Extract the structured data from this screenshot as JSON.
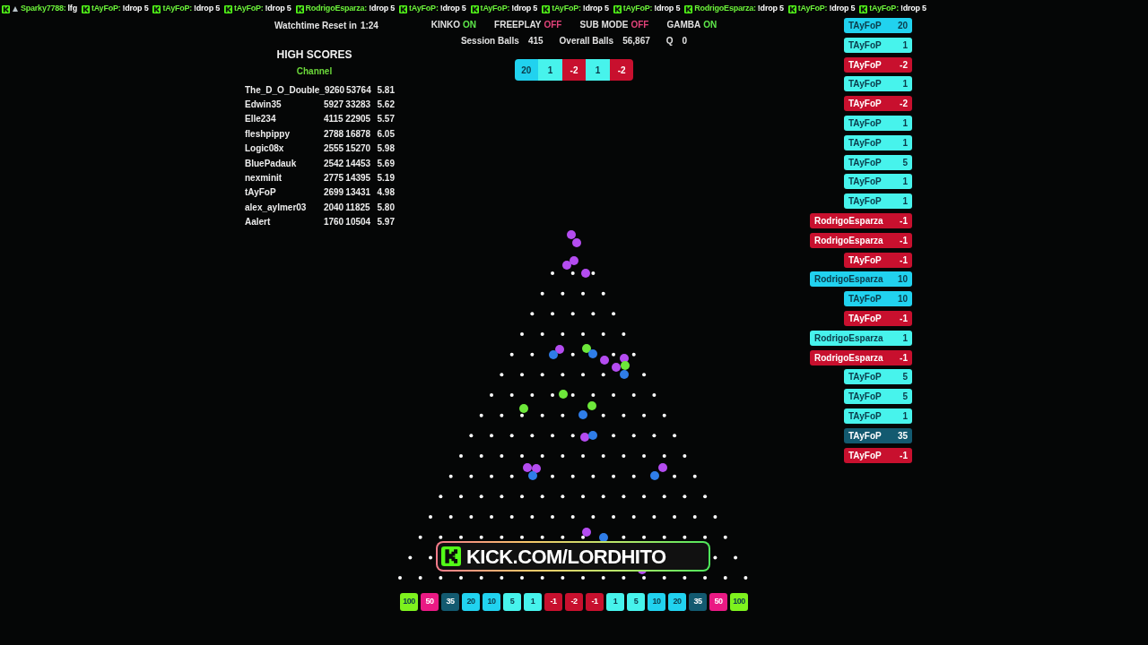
{
  "ticker": [
    {
      "user": "Sparky7788:",
      "text": "lfg",
      "badge": true
    },
    {
      "user": "tAyFoP:",
      "text": "!drop 5",
      "badge": false
    },
    {
      "user": "tAyFoP:",
      "text": "!drop 5",
      "badge": false
    },
    {
      "user": "tAyFoP:",
      "text": "!drop 5",
      "badge": false
    },
    {
      "user": "RodrigoEsparza:",
      "text": "!drop 5",
      "badge": false
    },
    {
      "user": "tAyFoP:",
      "text": "!drop 5",
      "badge": false
    },
    {
      "user": "tAyFoP:",
      "text": "!drop 5",
      "badge": false
    },
    {
      "user": "tAyFoP:",
      "text": "!drop 5",
      "badge": false
    },
    {
      "user": "tAyFoP:",
      "text": "!drop 5",
      "badge": false
    },
    {
      "user": "RodrigoEsparza:",
      "text": "!drop 5",
      "badge": false
    },
    {
      "user": "tAyFoP:",
      "text": "!drop 5",
      "badge": false
    },
    {
      "user": "tAyFoP:",
      "text": "!drop 5",
      "badge": false
    }
  ],
  "watchtime": {
    "label": "Watchtime Reset in",
    "value": "1:24"
  },
  "high_scores": {
    "title": "HIGH SCORES",
    "subtitle": "Channel",
    "rows": [
      {
        "name": "The_D_O_Double_",
        "col_2": "9260",
        "col_3": "53764",
        "col_4": "5.81"
      },
      {
        "name": "Edwin35",
        "col_2": "5927",
        "col_3": "33283",
        "col_4": "5.62"
      },
      {
        "name": "Elle234",
        "col_2": "4115",
        "col_3": "22905",
        "col_4": "5.57"
      },
      {
        "name": "fleshpippy",
        "col_2": "2788",
        "col_3": "16878",
        "col_4": "6.05"
      },
      {
        "name": "Logic08x",
        "col_2": "2555",
        "col_3": "15270",
        "col_4": "5.98"
      },
      {
        "name": "BluePadauk",
        "col_2": "2542",
        "col_3": "14453",
        "col_4": "5.69"
      },
      {
        "name": "nexminit",
        "col_2": "2775",
        "col_3": "14395",
        "col_4": "5.19"
      },
      {
        "name": "tAyFoP",
        "col_2": "2699",
        "col_3": "13431",
        "col_4": "4.98"
      },
      {
        "name": "alex_aylmer03",
        "col_2": "2040",
        "col_3": "11825",
        "col_4": "5.80"
      },
      {
        "name": "Aalert",
        "col_2": "1760",
        "col_3": "10504",
        "col_4": "5.97"
      }
    ]
  },
  "modes": [
    {
      "label": "KINKO",
      "value": "ON",
      "on": true
    },
    {
      "label": "FREEPLAY",
      "value": "OFF",
      "on": false
    },
    {
      "label": "SUB MODE",
      "value": "OFF",
      "on": false
    },
    {
      "label": "GAMBA",
      "value": "ON",
      "on": true
    }
  ],
  "stats": [
    {
      "label": "Session Balls",
      "value": "415"
    },
    {
      "label": "Overall Balls",
      "value": "56,867"
    },
    {
      "label": "Q",
      "value": "0"
    }
  ],
  "recent": [
    {
      "value": "20",
      "color": "#21d2ef"
    },
    {
      "value": "1",
      "color": "#47f3ec"
    },
    {
      "value": "-2",
      "color": "#c8102e"
    },
    {
      "value": "1",
      "color": "#47f3ec"
    },
    {
      "value": "-2",
      "color": "#c8102e"
    }
  ],
  "banner": {
    "text": "KICK.COM/LORDHITO"
  },
  "slots": [
    {
      "value": "100",
      "color": "#7ef21e"
    },
    {
      "value": "50",
      "color": "#ea1a84"
    },
    {
      "value": "35",
      "color": "#135a70"
    },
    {
      "value": "20",
      "color": "#21d2ef"
    },
    {
      "value": "10",
      "color": "#21d2ef"
    },
    {
      "value": "5",
      "color": "#47f3ec"
    },
    {
      "value": "1",
      "color": "#47f3ec"
    },
    {
      "value": "-1",
      "color": "#c8102e"
    },
    {
      "value": "-2",
      "color": "#c8102e"
    },
    {
      "value": "-1",
      "color": "#c8102e"
    },
    {
      "value": "1",
      "color": "#47f3ec"
    },
    {
      "value": "5",
      "color": "#47f3ec"
    },
    {
      "value": "10",
      "color": "#21d2ef"
    },
    {
      "value": "20",
      "color": "#21d2ef"
    },
    {
      "value": "35",
      "color": "#135a70"
    },
    {
      "value": "50",
      "color": "#ea1a84"
    },
    {
      "value": "100",
      "color": "#7ef21e"
    }
  ],
  "feed": [
    {
      "user": "TAyFoP",
      "value": "20",
      "color": "#21d2ef"
    },
    {
      "user": "TAyFoP",
      "value": "1",
      "color": "#47f3ec"
    },
    {
      "user": "TAyFoP",
      "value": "-2",
      "color": "#c8102e"
    },
    {
      "user": "TAyFoP",
      "value": "1",
      "color": "#47f3ec"
    },
    {
      "user": "TAyFoP",
      "value": "-2",
      "color": "#c8102e"
    },
    {
      "user": "TAyFoP",
      "value": "1",
      "color": "#47f3ec"
    },
    {
      "user": "TAyFoP",
      "value": "1",
      "color": "#47f3ec"
    },
    {
      "user": "TAyFoP",
      "value": "5",
      "color": "#47f3ec"
    },
    {
      "user": "TAyFoP",
      "value": "1",
      "color": "#47f3ec"
    },
    {
      "user": "TAyFoP",
      "value": "1",
      "color": "#47f3ec"
    },
    {
      "user": "RodrigoEsparza",
      "value": "-1",
      "color": "#c8102e"
    },
    {
      "user": "RodrigoEsparza",
      "value": "-1",
      "color": "#c8102e"
    },
    {
      "user": "TAyFoP",
      "value": "-1",
      "color": "#c8102e"
    },
    {
      "user": "RodrigoEsparza",
      "value": "10",
      "color": "#21d2ef"
    },
    {
      "user": "TAyFoP",
      "value": "10",
      "color": "#21d2ef"
    },
    {
      "user": "TAyFoP",
      "value": "-1",
      "color": "#c8102e"
    },
    {
      "user": "RodrigoEsparza",
      "value": "1",
      "color": "#47f3ec"
    },
    {
      "user": "RodrigoEsparza",
      "value": "-1",
      "color": "#c8102e"
    },
    {
      "user": "TAyFoP",
      "value": "5",
      "color": "#47f3ec"
    },
    {
      "user": "TAyFoP",
      "value": "5",
      "color": "#47f3ec"
    },
    {
      "user": "TAyFoP",
      "value": "1",
      "color": "#47f3ec"
    },
    {
      "user": "TAyFoP",
      "value": "35",
      "color": "#135a70"
    },
    {
      "user": "TAyFoP",
      "value": "-1",
      "color": "#c8102e"
    }
  ]
}
